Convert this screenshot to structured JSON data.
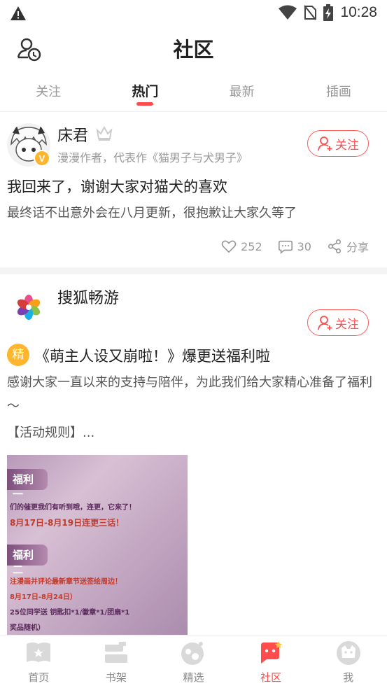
{
  "status_bar": {
    "time": "10:28"
  },
  "header": {
    "title": "社区"
  },
  "tabs": [
    {
      "label": "关注",
      "active": false
    },
    {
      "label": "热门",
      "active": true
    },
    {
      "label": "最新",
      "active": false
    },
    {
      "label": "插画",
      "active": false
    }
  ],
  "posts": [
    {
      "author": "床君",
      "author_desc": "漫漫作者，代表作《猫男子与犬男子》",
      "verified_badge": "V",
      "follow_label": "关注",
      "title": "我回来了，谢谢大家对猫犬的喜欢",
      "body": "最终话不出意外会在八月更新，很抱歉让大家久等了",
      "likes": "252",
      "comments": "30",
      "share_label": "分享"
    },
    {
      "author": "搜狐畅游",
      "follow_label": "关注",
      "badge": "精",
      "title": "《萌主人设又崩啦！》爆更送福利啦",
      "body": "感谢大家一直以来的支持与陪伴，为此我们给大家精心准备了福利～",
      "body_more": "【活动规则】...",
      "image": {
        "banner1": "福利一",
        "line1": "们的催更我们有听到哦，连更，它来了！",
        "line2": "8月17日-8月19日连更三话！",
        "banner2": "福利二",
        "line3": "注漫画并评论最新章节送签绘周边！",
        "line4": "8月17日-8月24日）",
        "line5": "25位同学送 钥匙扣*1/徽章*1/团扇*1",
        "line6": "奖品随机）"
      }
    }
  ],
  "bottom_nav": [
    {
      "label": "首页",
      "icon": "home-book-icon",
      "active": false
    },
    {
      "label": "书架",
      "icon": "bookshelf-icon",
      "active": false
    },
    {
      "label": "精选",
      "icon": "featured-icon",
      "active": false
    },
    {
      "label": "社区",
      "icon": "community-icon",
      "active": true
    },
    {
      "label": "我",
      "icon": "profile-icon",
      "active": false
    }
  ],
  "colors": {
    "accent": "#ff4d4d",
    "badge": "#ffb52e",
    "muted": "#999999"
  }
}
